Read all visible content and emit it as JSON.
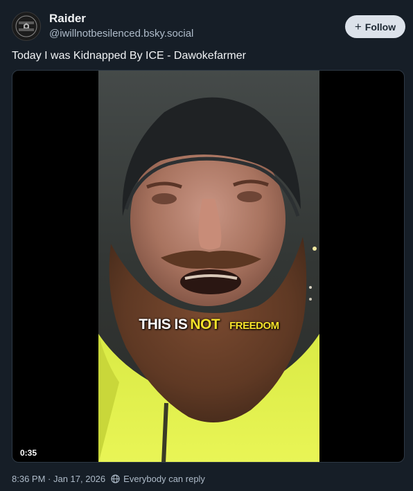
{
  "author": {
    "display_name": "Raider",
    "handle": "@iwillnotbesilenced.bsky.social",
    "avatar_icon": "badge-avatar",
    "avatar_text": "Forever Reading"
  },
  "follow_button": {
    "icon": "plus-icon",
    "label": "Follow"
  },
  "post": {
    "text": "Today I was Kidnapped By ICE - Dawokefarmer"
  },
  "video": {
    "caption_part1": "THIS IS",
    "caption_part2": "NOT",
    "caption_part3": "FREEDOM",
    "duration": "0:35"
  },
  "footer": {
    "timestamp": "8:36 PM · Jan 17, 2026",
    "reply_icon": "globe-icon",
    "reply_setting": "Everybody can reply"
  },
  "colors": {
    "background": "#161e27",
    "caption_yellow": "#f6e22a",
    "jacket_yellow": "#e3f24a",
    "secondary_text": "#aebbc9"
  }
}
